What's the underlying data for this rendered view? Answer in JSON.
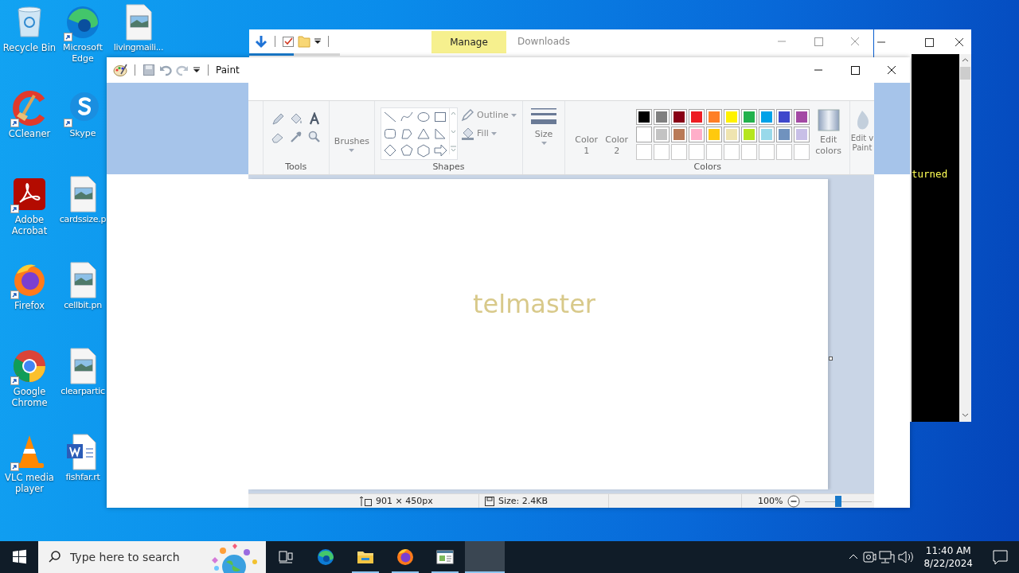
{
  "desktop": {
    "icons": [
      {
        "label": "Recycle Bin",
        "kind": "recycle",
        "shortcut": false
      },
      {
        "label": "CCleaner",
        "kind": "ccleaner",
        "shortcut": true
      },
      {
        "label": "Adobe Acrobat",
        "kind": "acrobat",
        "shortcut": true
      },
      {
        "label": "Firefox",
        "kind": "firefox",
        "shortcut": true
      },
      {
        "label": "Google Chrome",
        "kind": "chrome",
        "shortcut": true
      },
      {
        "label": "VLC media player",
        "kind": "vlc",
        "shortcut": true
      },
      {
        "label": "Microsoft Edge",
        "kind": "edge",
        "shortcut": true
      },
      {
        "label": "Skype",
        "kind": "skype",
        "shortcut": true
      },
      {
        "label": "cardssize.p",
        "kind": "image_file",
        "shortcut": false
      },
      {
        "label": "cellbit.pn",
        "kind": "image_file",
        "shortcut": false
      },
      {
        "label": "clearpartic",
        "kind": "image_file",
        "shortcut": false
      },
      {
        "label": "fishfar.rt",
        "kind": "word_file",
        "shortcut": false
      },
      {
        "label": "livingmaili...",
        "kind": "image_file",
        "shortcut": false
      }
    ]
  },
  "console_window": {
    "text": "turned"
  },
  "explorer_window": {
    "context_tab": "Manage",
    "title": "Downloads"
  },
  "paint_window": {
    "title": "Paint",
    "ribbon": {
      "tools_label": "Tools",
      "brushes_label": "Brushes",
      "shapes_label": "Shapes",
      "outline": "Outline",
      "fill": "Fill",
      "size_label": "Size",
      "color_1": "Color 1",
      "color_2": "Color 2",
      "colors_label": "Colors",
      "edit_colors": "Edit colors",
      "edit_with": "Edit v Paint",
      "palette": [
        {
          "kind": "swatch",
          "color": "#000000"
        },
        {
          "kind": "swatch",
          "color": "#7f7f7f"
        },
        {
          "kind": "swatch",
          "color": "#880015"
        },
        {
          "kind": "swatch",
          "color": "#ed1c24"
        },
        {
          "kind": "swatch",
          "color": "#ff7f27"
        },
        {
          "kind": "swatch",
          "color": "#fff200"
        },
        {
          "kind": "swatch",
          "color": "#22b14c"
        },
        {
          "kind": "swatch",
          "color": "#00a2e8"
        },
        {
          "kind": "swatch",
          "color": "#3f48cc"
        },
        {
          "kind": "swatch",
          "color": "#a349a4"
        },
        {
          "kind": "swatch",
          "color": "#ffffff"
        },
        {
          "kind": "swatch",
          "color": "#c3c3c3"
        },
        {
          "kind": "swatch",
          "color": "#b97a57"
        },
        {
          "kind": "swatch",
          "color": "#ffaec9"
        },
        {
          "kind": "swatch",
          "color": "#ffc90e"
        },
        {
          "kind": "swatch",
          "color": "#efe4b0"
        },
        {
          "kind": "swatch",
          "color": "#b5e61d"
        },
        {
          "kind": "swatch",
          "color": "#99d9ea"
        },
        {
          "kind": "swatch",
          "color": "#7092be"
        },
        {
          "kind": "swatch",
          "color": "#c8bfe7"
        },
        {
          "kind": "empty"
        },
        {
          "kind": "empty"
        },
        {
          "kind": "empty"
        },
        {
          "kind": "empty"
        },
        {
          "kind": "empty"
        },
        {
          "kind": "empty"
        },
        {
          "kind": "empty"
        },
        {
          "kind": "empty"
        },
        {
          "kind": "empty"
        },
        {
          "kind": "empty"
        }
      ]
    },
    "canvas": {
      "text": "telmaster"
    },
    "status_bar": {
      "dimensions": "901 × 450px",
      "size": "Size: 2.4KB",
      "zoom": "100%",
      "zoom_slider": {
        "level": 0.5
      }
    }
  },
  "taskbar": {
    "search": {
      "placeholder": "Type here to search"
    },
    "apps": [
      {
        "kind": "taskview",
        "running": false,
        "selected": false
      },
      {
        "kind": "edge",
        "running": false,
        "selected": false
      },
      {
        "kind": "explorer",
        "running": true,
        "selected": false
      },
      {
        "kind": "firefox",
        "running": true,
        "selected": false
      },
      {
        "kind": "window",
        "running": true,
        "selected": false
      },
      {
        "kind": "blank",
        "running": true,
        "selected": true
      }
    ],
    "time": "11:40 AM",
    "date": "8/22/2024"
  }
}
